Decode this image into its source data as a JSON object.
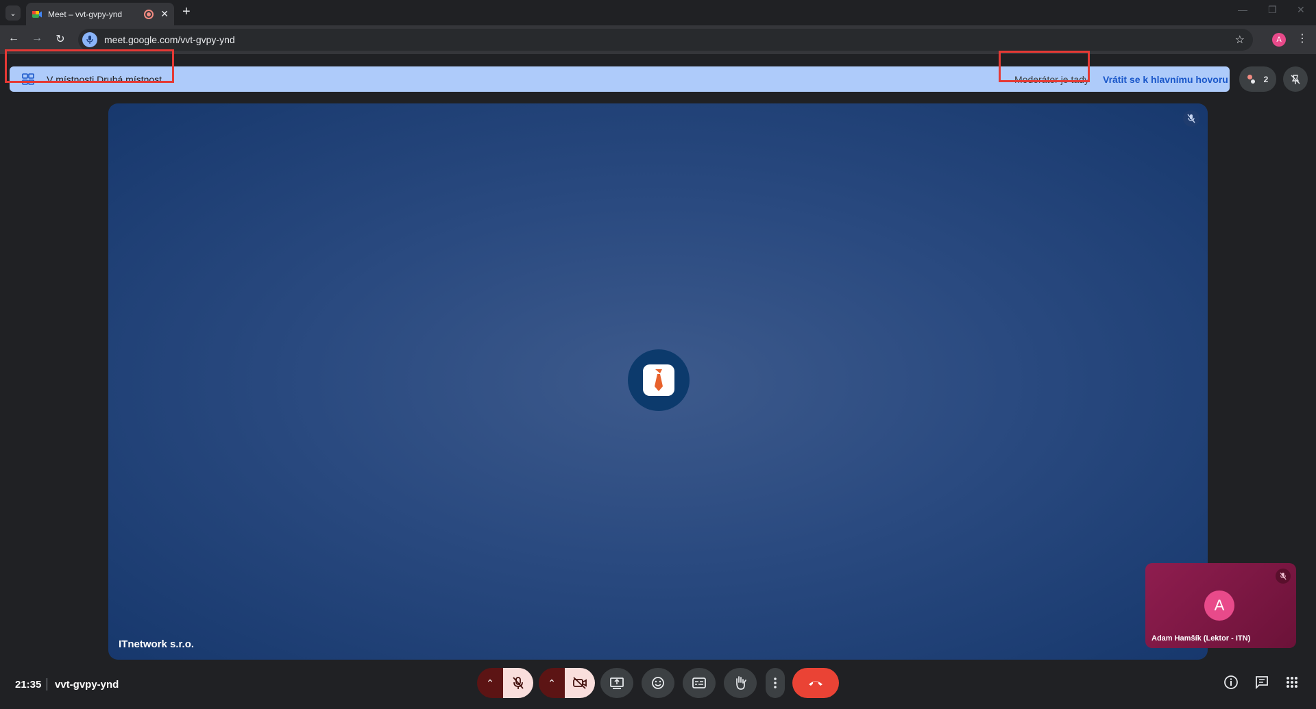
{
  "browser": {
    "tab_title": "Meet – vvt-gvpy-ynd",
    "url": "meet.google.com/vvt-gvpy-ynd",
    "profile_initial": "A"
  },
  "banner": {
    "room_label": "V místnosti Druhá místnost",
    "moderator_text": "Moderátor je tady",
    "return_link": "Vrátit se k hlavnímu hovoru",
    "accent": "#aecbfa"
  },
  "participants": {
    "count": "2"
  },
  "stage": {
    "presenter_name": "ITnetwork s.r.o."
  },
  "self_view": {
    "initial": "A",
    "name": "Adam Hamšík (Lektor - ITN)"
  },
  "footer": {
    "time": "21:35",
    "meeting_code": "vvt-gvpy-ynd"
  },
  "icons": [
    "search-tabs-icon",
    "record-icon",
    "close-icon",
    "plus-icon",
    "back-icon",
    "forward-icon",
    "reload-icon",
    "star-icon",
    "grid-icon",
    "pin-off-icon",
    "mic-off-icon",
    "camera-off-icon",
    "present-icon",
    "emoji-icon",
    "captions-icon",
    "raise-hand-icon",
    "more-icon",
    "hang-up-icon",
    "info-icon",
    "chat-icon",
    "apps-icon"
  ]
}
